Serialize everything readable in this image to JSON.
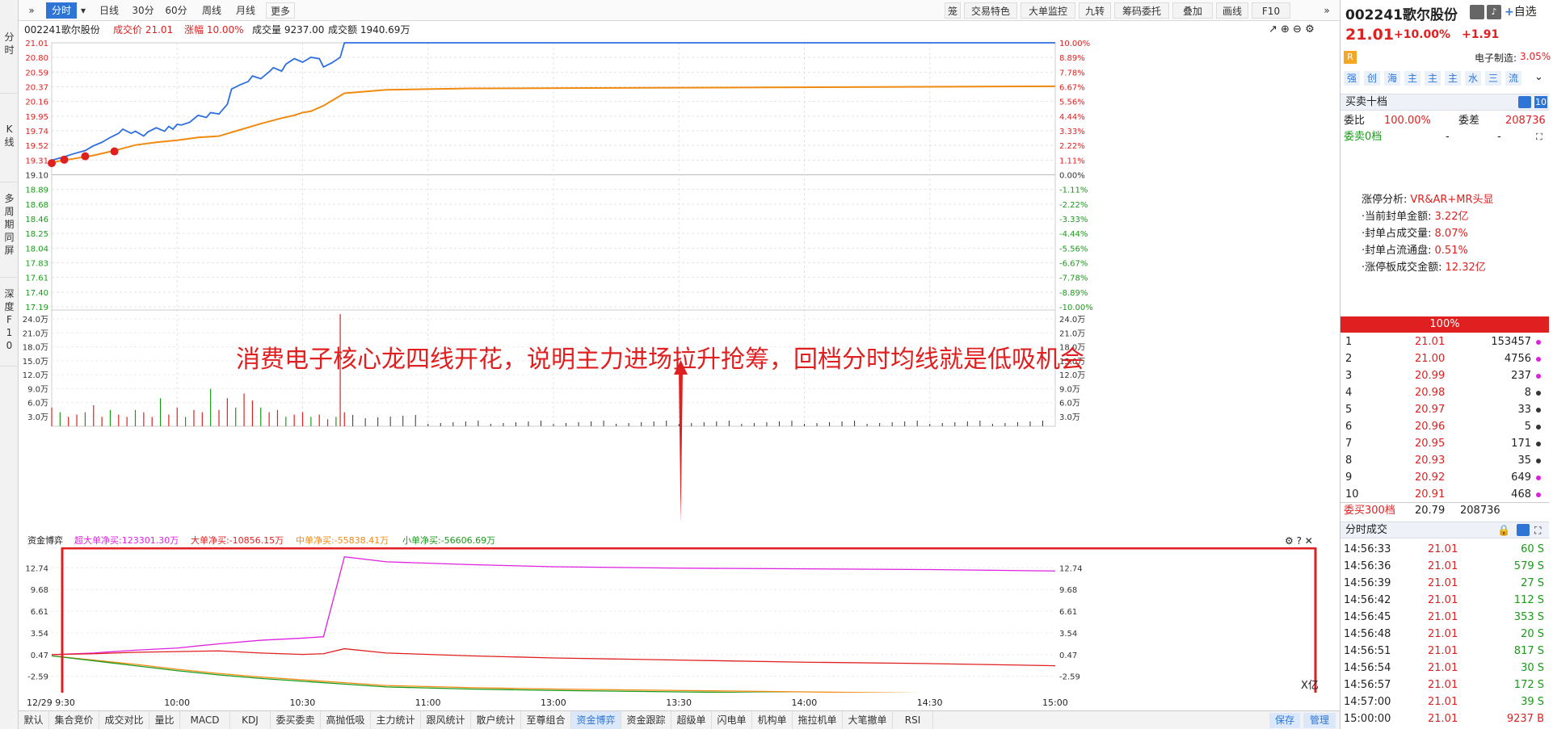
{
  "leftnav": [
    {
      "label": "分\n时",
      "active": true
    },
    {
      "label": "K\n线",
      "active": false
    },
    {
      "label": "多\n周\n期\n同\n屏",
      "active": false
    },
    {
      "label": "深\n度\nF\n1\n0",
      "active": false
    }
  ],
  "toolbar": {
    "expand_icon": "»",
    "tabs": [
      "分时",
      "日线",
      "30分",
      "60分",
      "周线",
      "月线",
      "更多"
    ],
    "right_tools": [
      "笼",
      "交易特色",
      "大单监控",
      "九转",
      "筹码委托",
      "叠加",
      "画线",
      "F10"
    ],
    "collapse_icon": "»"
  },
  "info": {
    "stock": "002241歌尔股份",
    "price": "成交价 21.01",
    "change": "涨幅 10.00%",
    "volume": "成交量 9237.00",
    "amount": "成交额 1940.69万"
  },
  "price_axis": {
    "left": [
      "21.01",
      "20.80",
      "20.59",
      "20.37",
      "20.16",
      "19.95",
      "19.74",
      "19.52",
      "19.31",
      "19.10",
      "18.89",
      "18.68",
      "18.46",
      "18.25",
      "18.04",
      "17.83",
      "17.61",
      "17.40",
      "17.19"
    ],
    "right": [
      "10.00%",
      "8.89%",
      "7.78%",
      "6.67%",
      "5.56%",
      "4.44%",
      "3.33%",
      "2.22%",
      "1.11%",
      "0.00%",
      "-1.11%",
      "-2.22%",
      "-3.33%",
      "-4.44%",
      "-5.56%",
      "-6.67%",
      "-7.78%",
      "-8.89%",
      "-10.00%"
    ]
  },
  "volume_axis": [
    "24.0万",
    "21.0万",
    "18.0万",
    "15.0万",
    "12.0万",
    "9.0万",
    "6.0万",
    "3.0万"
  ],
  "annotation": "消费电子核心龙四线开花，说明主力进场拉升抢筹，回档分时均线就是低吸机会",
  "fund_header": {
    "title": "资金博弈",
    "super_large": "超大单净买:123301.30万",
    "large": "大单净买:-10856.15万",
    "medium": "中单净买:-55838.41万",
    "small": "小单净买:-56606.69万"
  },
  "fund_axis": [
    "12.74",
    "9.68",
    "6.61",
    "3.54",
    "0.47",
    "-2.59"
  ],
  "fund_unit": "X亿",
  "time_axis": [
    "12/29 9:30",
    "10:00",
    "10:30",
    "11:00",
    "13:00",
    "13:30",
    "14:00",
    "14:30",
    "15:00"
  ],
  "bottom_tabs": [
    "默认",
    "集合竞价",
    "成交对比",
    "量比",
    "MACD",
    "KDJ",
    "委买委卖",
    "高抛低吸",
    "主力统计",
    "跟风统计",
    "散户统计",
    "至尊组合",
    "资金博弈",
    "资金跟踪",
    "超级单",
    "闪电单",
    "机构单",
    "拖拉机单",
    "大笔撤单",
    "RSI"
  ],
  "bottom_active": "资金博弈",
  "bottom_buttons": [
    "保存",
    "管理"
  ],
  "right": {
    "title": "002241歌尔股份",
    "add_watch": "自选",
    "price": "21.01",
    "pct": "+10.00%",
    "chg": "+1.91",
    "r_badge": "R",
    "industry": "电子制造:",
    "industry_pct": "3.05%",
    "icons": [
      "强",
      "创",
      "海",
      "主",
      "主",
      "主",
      "水",
      "三",
      "流"
    ],
    "book_title": "买卖十档",
    "book_num": "10",
    "weibi_label": "委比",
    "weibi": "100.00%",
    "weicha_label": "委差",
    "weicha": "208736",
    "sell0": "委卖0档",
    "dash": "-",
    "analysis": [
      {
        "k": "涨停分析:",
        "v": "VR&AR+MR头显"
      },
      {
        "k": "·当前封单金额:",
        "v": "3.22亿"
      },
      {
        "k": "·封单占成交量:",
        "v": "8.07%"
      },
      {
        "k": "·封单占流通盘:",
        "v": "0.51%"
      },
      {
        "k": "·涨停板成交金额:",
        "v": "12.32亿"
      }
    ],
    "pct_bar": "100%",
    "bids": [
      {
        "n": "1",
        "p": "21.01",
        "v": "153457",
        "dot": "#e020e0"
      },
      {
        "n": "2",
        "p": "21.00",
        "v": "4756",
        "dot": "#e020e0"
      },
      {
        "n": "3",
        "p": "20.99",
        "v": "237",
        "dot": "#e020e0"
      },
      {
        "n": "4",
        "p": "20.98",
        "v": "8",
        "dot": "#333333"
      },
      {
        "n": "5",
        "p": "20.97",
        "v": "33",
        "dot": "#333333"
      },
      {
        "n": "6",
        "p": "20.96",
        "v": "5",
        "dot": "#333333"
      },
      {
        "n": "7",
        "p": "20.95",
        "v": "171",
        "dot": "#333333"
      },
      {
        "n": "8",
        "p": "20.93",
        "v": "35",
        "dot": "#333333"
      },
      {
        "n": "9",
        "p": "20.92",
        "v": "649",
        "dot": "#e020e0"
      },
      {
        "n": "10",
        "p": "20.91",
        "v": "468",
        "dot": "#e020e0"
      }
    ],
    "buy300_label": "委买300档",
    "buy300_price": "20.79",
    "buy300_vol": "208736",
    "trades_title": "分时成交",
    "trades": [
      {
        "t": "14:56:33",
        "p": "21.01",
        "v": "60 S"
      },
      {
        "t": "14:56:36",
        "p": "21.01",
        "v": "579 S"
      },
      {
        "t": "14:56:39",
        "p": "21.01",
        "v": "27 S"
      },
      {
        "t": "14:56:42",
        "p": "21.01",
        "v": "112 S"
      },
      {
        "t": "14:56:45",
        "p": "21.01",
        "v": "353 S"
      },
      {
        "t": "14:56:48",
        "p": "21.01",
        "v": "20 S"
      },
      {
        "t": "14:56:51",
        "p": "21.01",
        "v": "817 S"
      },
      {
        "t": "14:56:54",
        "p": "21.01",
        "v": "30 S"
      },
      {
        "t": "14:56:57",
        "p": "21.01",
        "v": "172 S"
      },
      {
        "t": "14:57:00",
        "p": "21.01",
        "v": "39 S"
      },
      {
        "t": "15:00:00",
        "p": "21.01",
        "v": "9237 B"
      }
    ]
  },
  "chart_data": [
    {
      "type": "line",
      "series": [
        {
          "color": "#2e6fe0",
          "x_minutes": [
            0,
            3,
            5,
            8,
            10,
            12,
            14,
            16,
            17,
            19,
            20,
            22,
            23,
            25,
            27,
            28,
            29,
            30,
            31,
            33,
            35,
            37,
            38,
            40,
            42,
            43,
            45,
            47,
            48,
            50,
            52,
            53,
            55,
            56,
            58,
            60,
            62,
            64,
            65,
            67,
            69,
            70,
            240
          ],
          "values": [
            19.31,
            19.36,
            19.4,
            19.45,
            19.52,
            19.57,
            19.64,
            19.7,
            19.76,
            19.7,
            19.73,
            19.66,
            19.72,
            19.78,
            19.73,
            19.8,
            19.76,
            19.83,
            19.82,
            19.86,
            19.96,
            19.93,
            20.0,
            19.98,
            20.12,
            20.34,
            20.4,
            20.45,
            20.53,
            20.49,
            20.59,
            20.65,
            20.6,
            20.7,
            20.78,
            20.73,
            20.8,
            20.78,
            20.66,
            20.72,
            20.8,
            21.01,
            21.01
          ]
        },
        {
          "color": "#f08a10",
          "x_minutes": [
            0,
            5,
            10,
            15,
            20,
            25,
            30,
            35,
            40,
            45,
            50,
            55,
            58,
            60,
            62,
            65,
            70,
            80,
            100,
            150,
            240
          ],
          "values": [
            19.28,
            19.33,
            19.38,
            19.45,
            19.53,
            19.57,
            19.6,
            19.64,
            19.66,
            19.75,
            19.84,
            19.92,
            19.96,
            20.0,
            20.02,
            20.1,
            20.28,
            20.33,
            20.35,
            20.36,
            20.38
          ]
        }
      ],
      "ylim": [
        17.19,
        21.01
      ]
    },
    {
      "type": "bar",
      "ylim": [
        0,
        240000
      ],
      "spike_minutes": [
        0,
        2,
        4,
        6,
        8,
        10,
        12,
        14,
        16,
        18,
        20,
        22,
        24,
        26,
        28,
        30,
        32,
        34,
        36,
        38,
        40,
        42,
        44,
        46,
        48,
        50,
        52,
        54,
        56,
        58,
        60,
        62,
        64,
        66,
        68,
        69,
        70
      ],
      "spike_values": [
        40000,
        30000,
        20000,
        25000,
        30000,
        45000,
        20000,
        35000,
        25000,
        20000,
        35000,
        30000,
        20000,
        60000,
        25000,
        40000,
        20000,
        35000,
        30000,
        80000,
        35000,
        60000,
        40000,
        70000,
        55000,
        40000,
        30000,
        35000,
        20000,
        25000,
        30000,
        20000,
        25000,
        15000,
        20000,
        260000,
        30000
      ]
    },
    {
      "type": "line",
      "ylim": [
        -4.0,
        14.5
      ],
      "series": [
        {
          "name": "超大单净买",
          "color": "#e020e0",
          "x_minutes": [
            0,
            10,
            20,
            30,
            40,
            50,
            60,
            65,
            70,
            80,
            100,
            120,
            150,
            180,
            210,
            240
          ],
          "values": [
            0.47,
            0.7,
            1.1,
            1.4,
            2.0,
            2.5,
            2.8,
            3.0,
            14.3,
            13.6,
            13.2,
            12.9,
            12.7,
            12.6,
            12.5,
            12.3
          ]
        },
        {
          "name": "大单净买",
          "color": "#e02020",
          "x_minutes": [
            0,
            10,
            20,
            30,
            40,
            50,
            60,
            65,
            70,
            80,
            100,
            120,
            150,
            180,
            210,
            240
          ],
          "values": [
            0.47,
            0.6,
            0.8,
            0.9,
            1.0,
            0.7,
            0.5,
            0.6,
            1.3,
            0.7,
            0.3,
            0.0,
            -0.3,
            -0.6,
            -0.8,
            -1.1
          ]
        },
        {
          "name": "中单净买",
          "color": "#f08a10",
          "x_minutes": [
            0,
            10,
            20,
            30,
            40,
            50,
            60,
            70,
            80,
            100,
            120,
            150,
            180,
            210,
            240
          ],
          "values": [
            0.3,
            -0.3,
            -0.9,
            -1.6,
            -2.2,
            -2.7,
            -3.1,
            -3.5,
            -3.9,
            -4.2,
            -4.4,
            -4.6,
            -4.8,
            -5.0,
            -5.3
          ]
        },
        {
          "name": "小单净买",
          "color": "#1a9a1a",
          "x_minutes": [
            0,
            10,
            20,
            30,
            40,
            50,
            60,
            70,
            80,
            100,
            120,
            150,
            180,
            210,
            240
          ],
          "values": [
            0.3,
            -0.4,
            -1.1,
            -1.8,
            -2.4,
            -2.9,
            -3.3,
            -3.7,
            -4.1,
            -4.4,
            -4.6,
            -4.8,
            -5.0,
            -5.2,
            -5.5
          ]
        }
      ]
    }
  ]
}
